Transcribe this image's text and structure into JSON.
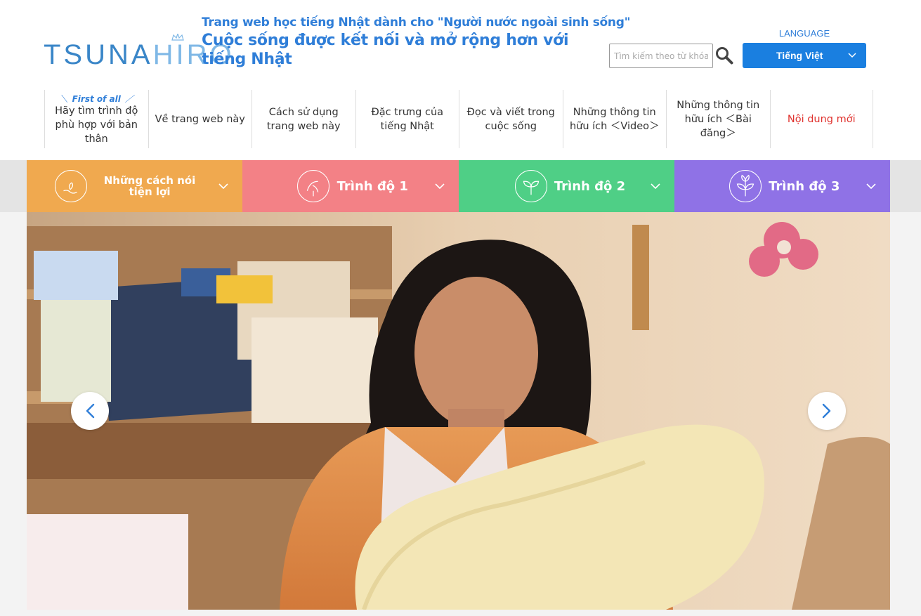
{
  "logo": {
    "text_dark": "TSUNA",
    "text_light": "HIRO"
  },
  "header": {
    "tagline_small": "Trang web học tiếng Nhật dành cho \"Người nước ngoài sinh sống\"",
    "tagline_big": "Cuộc sống được kết nối và mở rộng hơn với tiếng Nhật"
  },
  "search": {
    "placeholder": "Tìm kiếm theo từ khóa",
    "value": ""
  },
  "language": {
    "label": "LANGUAGE",
    "selected": "Tiếng Việt"
  },
  "nav": {
    "first_of_all": "First of all",
    "items": [
      {
        "label": "Hãy tìm trình độ phù hợp với bản thân"
      },
      {
        "label": "Về trang web này"
      },
      {
        "label": "Cách sử dụng trang web này"
      },
      {
        "label": "Đặc trưng của tiếng Nhật"
      },
      {
        "label": "Đọc và viết trong cuộc sống"
      },
      {
        "label": "Những thông tin hữu ích ＜Video＞"
      },
      {
        "label": "Những thông tin hữu ích ＜Bài đăng＞"
      },
      {
        "label": "Nội dung mới"
      }
    ]
  },
  "levels": [
    {
      "label": "Những cách nói tiện lợi",
      "color": "#f0a94f",
      "icon": "hand-sprout-icon"
    },
    {
      "label": "Trình độ 1",
      "color": "#f38186",
      "icon": "sprout-icon"
    },
    {
      "label": "Trình độ 2",
      "color": "#4fcf86",
      "icon": "seedling-icon"
    },
    {
      "label": "Trình độ 3",
      "color": "#8f72e6",
      "icon": "plant-icon"
    }
  ],
  "colors": {
    "brand_blue": "#2f7ed8",
    "button_blue": "#1a7fe0",
    "new_red": "#e0332f"
  }
}
